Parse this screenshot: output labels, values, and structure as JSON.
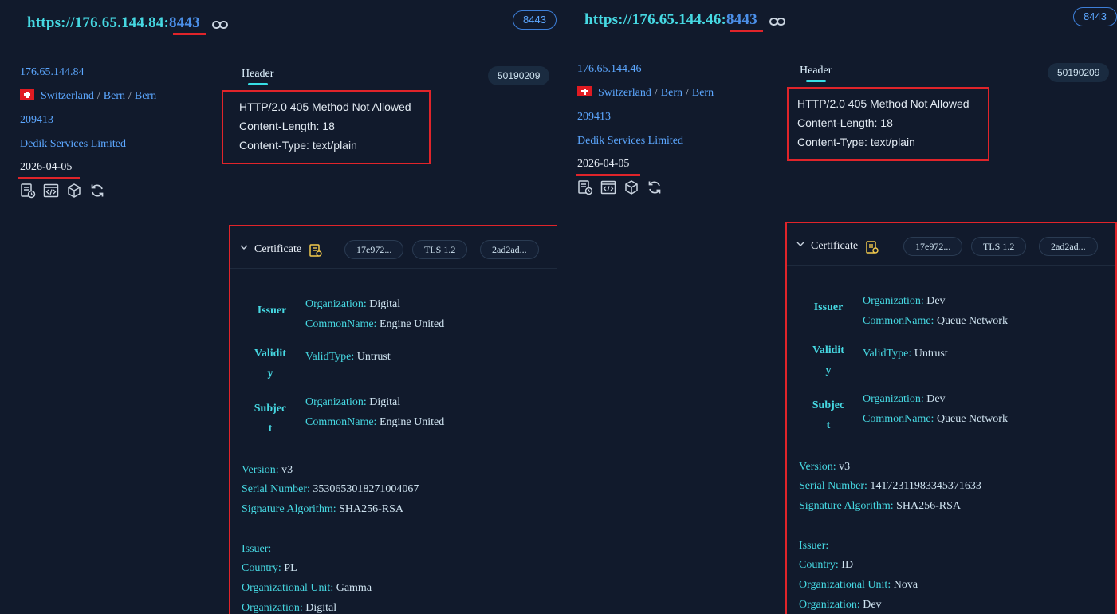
{
  "left": {
    "url_prefix": "https://176.65.144.84:",
    "port": "8443",
    "port_badge": "8443",
    "ip": "176.65.144.84",
    "country": "Switzerland",
    "region": "Bern",
    "city": "Bern",
    "asn": "209413",
    "org": "Dedik Services Limited",
    "date": "2026-04-05",
    "tab_header": "Header",
    "hash_badge": "50190209",
    "header_lines": [
      "HTTP/2.0 405 Method Not Allowed",
      "Content-Length: 18",
      "Content-Type: text/plain"
    ],
    "cert": {
      "title": "Certificate",
      "pills": [
        "17e972...",
        "TLS 1.2",
        "2ad2ad..."
      ],
      "issuer_key": "Issuer",
      "issuer_org_label": "Organization:",
      "issuer_org": "Digital",
      "issuer_cn_label": "CommonName:",
      "issuer_cn": "Engine United",
      "validity_key_1": "Validit",
      "validity_key_2": "y",
      "validtype_label": "ValidType:",
      "validtype": "Untrust",
      "subject_key_1": "Subjec",
      "subject_key_2": "t",
      "subject_org_label": "Organization:",
      "subject_org": "Digital",
      "subject_cn_label": "CommonName:",
      "subject_cn": "Engine United",
      "version_label": "Version:",
      "version": "v3",
      "serial_label": "Serial Number:",
      "serial": "3530653018271004067",
      "sigalg_label": "Signature Algorithm:",
      "sigalg": "SHA256-RSA",
      "issuer_section": "Issuer:",
      "country_label": "Country:",
      "country": "PL",
      "ou_label": "Organizational Unit:",
      "ou": "Gamma",
      "org_label": "Organization:",
      "org": "Digital"
    }
  },
  "right": {
    "url_prefix": "https://176.65.144.46:",
    "port": "8443",
    "port_badge": "8443",
    "ip": "176.65.144.46",
    "country": "Switzerland",
    "region": "Bern",
    "city": "Bern",
    "asn": "209413",
    "org": "Dedik Services Limited",
    "date": "2026-04-05",
    "tab_header": "Header",
    "hash_badge": "50190209",
    "header_lines": [
      "HTTP/2.0 405 Method Not Allowed",
      "Content-Length: 18",
      "Content-Type: text/plain"
    ],
    "cert": {
      "title": "Certificate",
      "pills": [
        "17e972...",
        "TLS 1.2",
        "2ad2ad..."
      ],
      "issuer_key": "Issuer",
      "issuer_org_label": "Organization:",
      "issuer_org": "Dev",
      "issuer_cn_label": "CommonName:",
      "issuer_cn": "Queue Network",
      "validity_key_1": "Validit",
      "validity_key_2": "y",
      "validtype_label": "ValidType:",
      "validtype": "Untrust",
      "subject_key_1": "Subjec",
      "subject_key_2": "t",
      "subject_org_label": "Organization:",
      "subject_org": "Dev",
      "subject_cn_label": "CommonName:",
      "subject_cn": "Queue Network",
      "version_label": "Version:",
      "version": "v3",
      "serial_label": "Serial Number:",
      "serial": "14172311983345371633",
      "sigalg_label": "Signature Algorithm:",
      "sigalg": "SHA256-RSA",
      "issuer_section": "Issuer:",
      "country_label": "Country:",
      "country": "ID",
      "ou_label": "Organizational Unit:",
      "ou": "Nova",
      "org_label": "Organization:",
      "org": "Dev"
    }
  },
  "colors": {
    "accent_cyan": "#46d8e2",
    "link_blue": "#5ca7ff",
    "highlight_red": "#e0242a",
    "panel_bg": "#111a2c"
  },
  "icons": [
    "link-icon",
    "switzerland-flag-icon",
    "report-icon",
    "code-icon",
    "cube-icon",
    "refresh-icon",
    "chevron-down-icon",
    "certificate-icon"
  ]
}
